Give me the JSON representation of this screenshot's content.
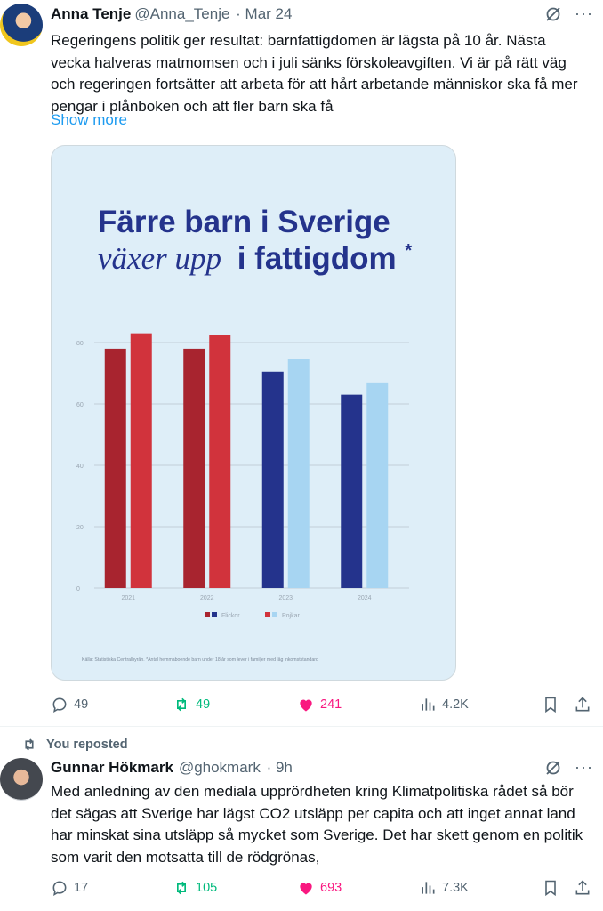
{
  "tweet1": {
    "name": "Anna Tenje",
    "handle": "@Anna_Tenje",
    "time": "· Mar 24",
    "text": "Regeringens politik ger resultat: barnfattigdomen är lägsta på 10 år. Nästa vecka halveras matmomsen och i juli sänks förskoleavgiften. Vi är på rätt väg och regeringen fortsätter att arbeta för att hårt arbetande människor ska få mer pengar i plånboken och att fler barn ska få",
    "show_more": "Show more",
    "replies": "49",
    "reposts": "49",
    "likes": "241",
    "views": "4.2K"
  },
  "chart_image": {
    "title_line1": "Färre barn i Sverige",
    "title_line2_italic": "växer upp",
    "title_line2_bold": "i fattigdom",
    "asterisk": "*",
    "source": "Källa: Statistiska Centralbyrån. *Antal hemmaboende barn under 18 år som lever i familjer med låg inkomststandard"
  },
  "chart_data": {
    "type": "bar",
    "categories": [
      "2021",
      "2022",
      "2023",
      "2024"
    ],
    "series": [
      {
        "name": "Flickor",
        "values": [
          78,
          78,
          70.5,
          63
        ]
      },
      {
        "name": "Pojkar",
        "values": [
          83,
          82.5,
          74.5,
          67
        ]
      }
    ],
    "yticks": [
      "0",
      "20'",
      "40'",
      "60'",
      "80'"
    ],
    "ylim": [
      0,
      80
    ],
    "colors": {
      "flickor_early": "#a8242f",
      "pojkar_early": "#d1333c",
      "flickor_late": "#24338c",
      "pojkar_late": "#a7d5f2"
    },
    "grid": true,
    "legend": "bottom-center"
  },
  "repost_banner": "You reposted",
  "tweet2": {
    "name": "Gunnar Hökmark",
    "handle": "@ghokmark",
    "time": "· 9h",
    "text": "Med anledning av den mediala upprördheten kring Klimatpolitiska rådet så bör det sägas att Sverige har lägst CO2 utsläpp per capita och att inget annat land har minskat sina utsläpp så mycket som Sverige. Det har skett genom en politik som varit den motsatta till de rödgrönas,",
    "replies": "17",
    "reposts": "105",
    "likes": "693",
    "views": "7.3K"
  }
}
